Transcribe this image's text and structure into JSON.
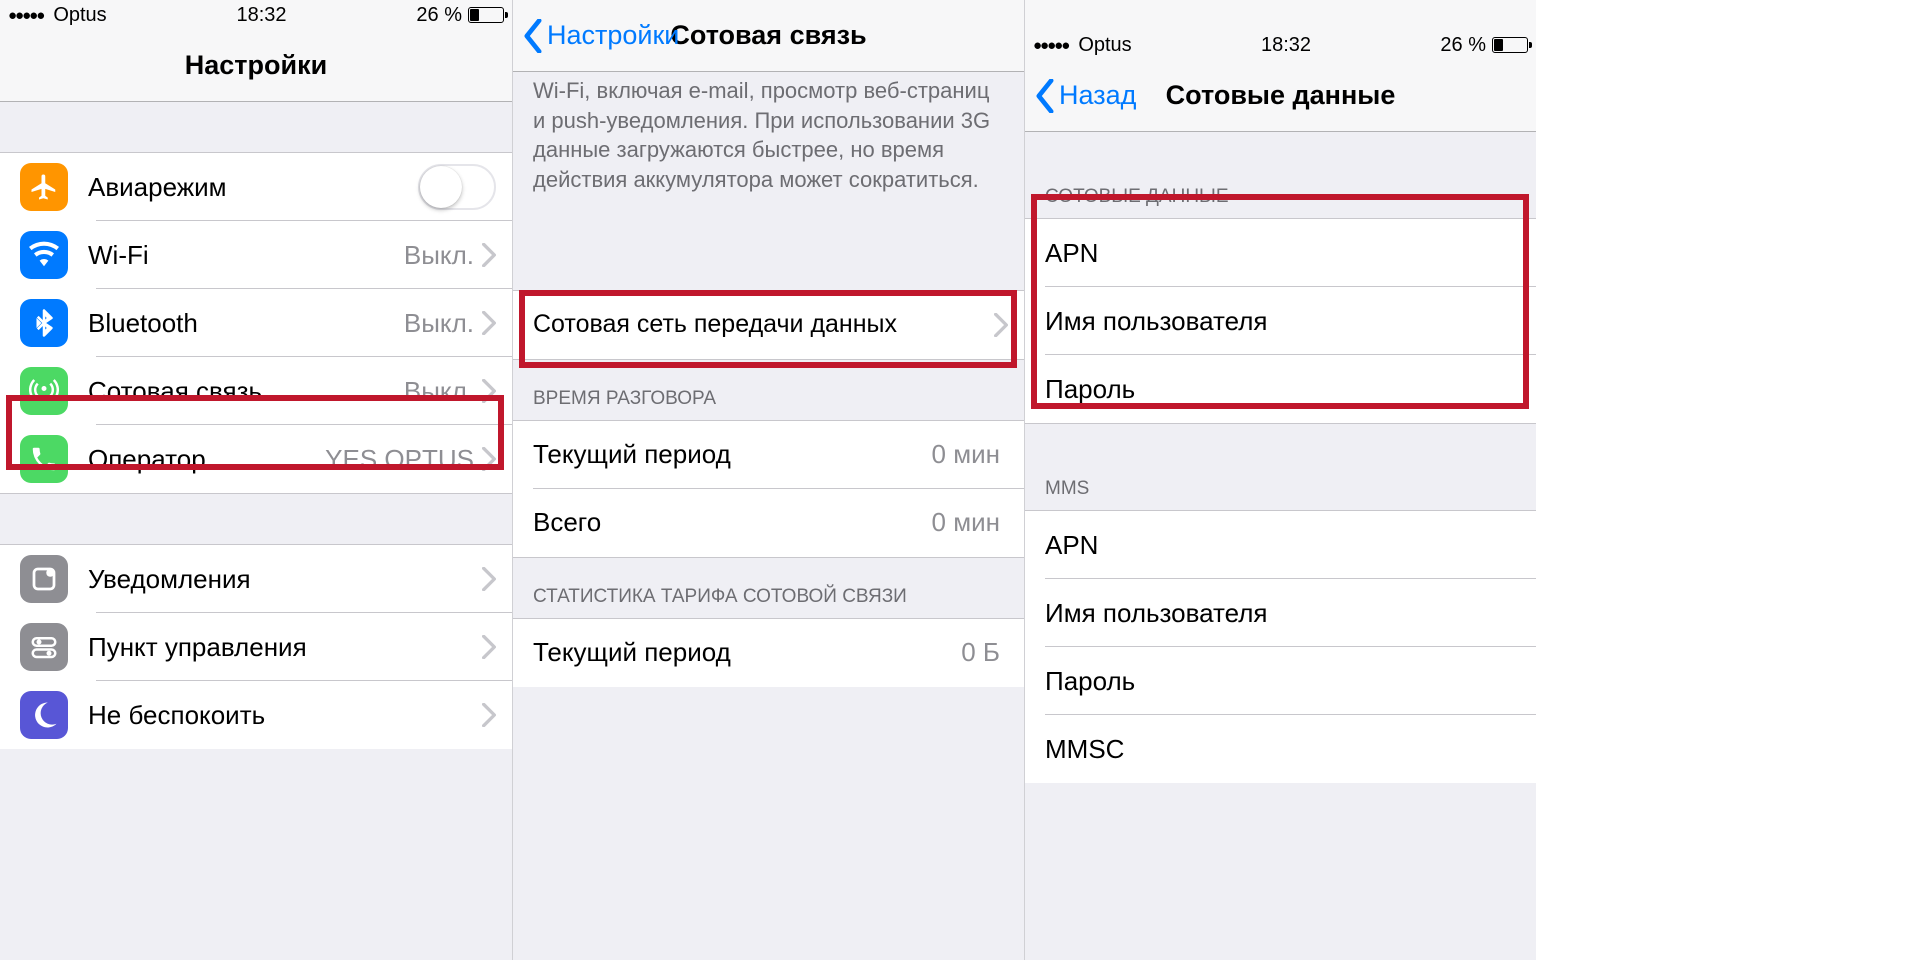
{
  "status": {
    "carrier": "Optus",
    "time": "18:32",
    "battery_pct": "26 %",
    "battery_fill": 26
  },
  "screen1": {
    "title": "Настройки",
    "rows_a": [
      {
        "icon": "airplane",
        "bg": "#ff9500",
        "label": "Авиарежим",
        "value": "",
        "ctrl": "toggle"
      },
      {
        "icon": "wifi",
        "bg": "#007aff",
        "label": "Wi-Fi",
        "value": "Выкл.",
        "ctrl": "disclosure"
      },
      {
        "icon": "bluetooth",
        "bg": "#007aff",
        "label": "Bluetooth",
        "value": "Выкл.",
        "ctrl": "disclosure"
      },
      {
        "icon": "cellular",
        "bg": "#4cd964",
        "label": "Сотовая связь",
        "value": "Выкл.",
        "ctrl": "disclosure"
      },
      {
        "icon": "phone",
        "bg": "#4cd964",
        "label": "Оператор",
        "value": "YES OPTUS",
        "ctrl": "disclosure"
      }
    ],
    "rows_b": [
      {
        "icon": "notify",
        "bg": "#8e8e93",
        "label": "Уведомления",
        "value": "",
        "ctrl": "disclosure"
      },
      {
        "icon": "controlcenter",
        "bg": "#8e8e93",
        "label": "Пункт управления",
        "value": "",
        "ctrl": "disclosure"
      },
      {
        "icon": "dnd",
        "bg": "#5856d6",
        "label": "Не беспокоить",
        "value": "",
        "ctrl": "disclosure"
      }
    ]
  },
  "screen2": {
    "back": "Настройки",
    "title": "Сотовая связь",
    "desc": "Wi-Fi, включая e-mail, просмотр веб-страниц и push-уведомления. При использовании 3G данные загружаются быстрее, но время действия аккумулятора может сократиться.",
    "row_main": "Сотовая сеть передачи данных",
    "header_time": "ВРЕМЯ РАЗГОВОРА",
    "rows_time": [
      {
        "label": "Текущий период",
        "value": "0 мин"
      },
      {
        "label": "Всего",
        "value": "0 мин"
      }
    ],
    "header_stats": "СТАТИСТИКА ТАРИФА СОТОВОЙ СВЯЗИ",
    "rows_stats": [
      {
        "label": "Текущий период",
        "value": "0 Б"
      }
    ]
  },
  "screen3": {
    "back": "Назад",
    "title": "Сотовые данные",
    "header1": "СОТОВЫЕ ДАННЫЕ",
    "rows1": [
      "APN",
      "Имя пользователя",
      "Пароль"
    ],
    "header2": "MMS",
    "rows2": [
      "APN",
      "Имя пользователя",
      "Пароль",
      "MMSC"
    ]
  }
}
